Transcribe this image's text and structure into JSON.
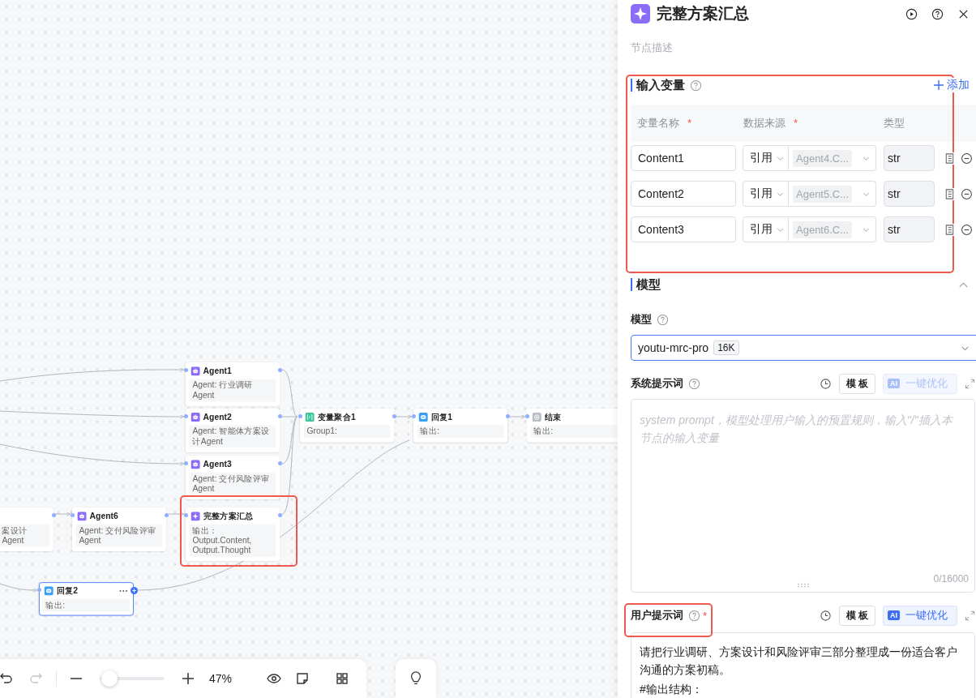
{
  "canvas": {
    "nodes": [
      {
        "kind": "agent",
        "title": "Agent1",
        "body": "Agent: 行业调研Agent",
        "selected": false
      },
      {
        "kind": "agent",
        "title": "Agent2",
        "body": "Agent: 智能体方案设计Agent",
        "selected": false
      },
      {
        "kind": "agent",
        "title": "Agent3",
        "body": "Agent: 交付风险评审Agent",
        "selected": false
      },
      {
        "kind": "aggregate",
        "title": "变量聚合1",
        "body": "Group1:",
        "selected": false
      },
      {
        "kind": "reply",
        "title": "回复1",
        "body": "输出:",
        "selected": false
      },
      {
        "kind": "end",
        "title": "结束",
        "body": "输出:",
        "selected": false
      },
      {
        "kind": "agent",
        "body": "案设计Agent",
        "selected": false
      },
      {
        "kind": "agent",
        "title": "Agent6",
        "body": "Agent: 交付风险评审Agent",
        "selected": false
      },
      {
        "kind": "summary",
        "title": "完整方案汇总",
        "body": "输出：  Output.Content, Output.Thought",
        "selected": false
      },
      {
        "kind": "reply",
        "title": "回复2",
        "body": "输出:",
        "selected": true
      }
    ],
    "zoom": {
      "level": 0.15,
      "reading": "47%"
    }
  },
  "panel": {
    "title": "完整方案汇总",
    "description": {
      "placeholder": "节点描述"
    },
    "inputs": {
      "title": "输入变量",
      "add_label": "添加",
      "columns": [
        {
          "label": "变量名称",
          "required_mark": "*"
        },
        {
          "label": "数据来源",
          "required_mark": "*"
        },
        {
          "label": "类型"
        }
      ],
      "rows": [
        {
          "name": "Content1",
          "source_mode": "引用",
          "source_value": "Agent4.C...",
          "type": "str"
        },
        {
          "name": "Content2",
          "source_mode": "引用",
          "source_value": "Agent5.C...",
          "type": "str"
        },
        {
          "name": "Content3",
          "source_mode": "引用",
          "source_value": "Agent6.C...",
          "type": "str"
        }
      ]
    },
    "model_section": {
      "title": "模型",
      "expanded": true,
      "field_label": "模型",
      "model": "youtu-mrc-pro",
      "context_badge": "16K"
    },
    "prompts": [
      {
        "label": "系统提示词",
        "template_button": "模 板",
        "ai_badge": "AI",
        "optimize_button": "一键优化",
        "optimize_disabled": true,
        "placeholder": "system prompt，模型处理用户输入的预置规则，输入\"/\"插入本节点的输入变量",
        "counter": "0/16000"
      },
      {
        "label": "用户提示词",
        "required_mark": "*",
        "template_button": "模 板",
        "ai_badge": "AI",
        "optimize_button": "一键优化",
        "optimize_disabled": false,
        "lines": [
          "请把行业调研、方案设计和风险评审三部分整理成一份适合客户沟通的方案初稿。",
          "#输出结构："
        ]
      }
    ]
  }
}
